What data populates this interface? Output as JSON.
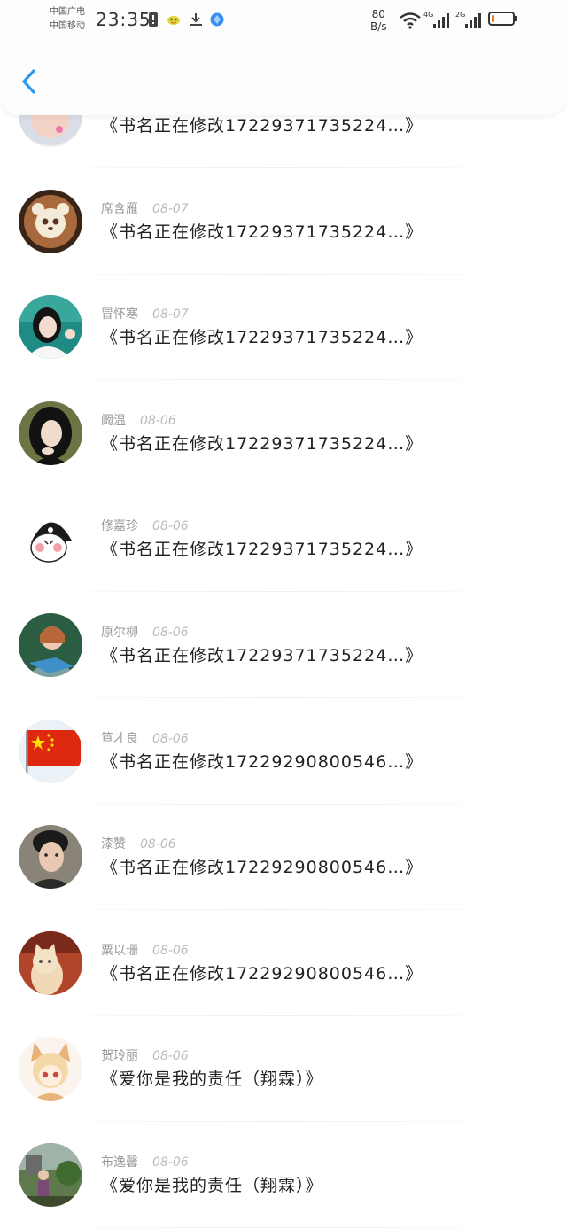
{
  "status_bar": {
    "carrier_1": "中国广电",
    "carrier_2": "中国移动",
    "time": "23:35",
    "net_speed_value": "80",
    "net_speed_unit": "B/s",
    "signal_1_label": "4G",
    "signal_2_label": "2G",
    "battery_level": 0.15,
    "battery_color": "#f07a1a"
  },
  "header": {
    "back_icon": "chevron-left-icon",
    "accent": "#2b9af3"
  },
  "items": [
    {
      "user": "",
      "date": "",
      "book": "《书名正在修改17229371735224…》",
      "avatar": "girl-partial"
    },
    {
      "user": "席含雁",
      "date": "08-07",
      "book": "《书名正在修改17229371735224…》",
      "avatar": "panda-latte"
    },
    {
      "user": "冒怀寒",
      "date": "08-07",
      "book": "《书名正在修改17229371735224…》",
      "avatar": "girl-portrait"
    },
    {
      "user": "阚温",
      "date": "08-06",
      "book": "《书名正在修改17229371735224…》",
      "avatar": "girl-dark-hair"
    },
    {
      "user": "修嘉珍",
      "date": "08-06",
      "book": "《书名正在修改17229371735224…》",
      "avatar": "cartoon-character"
    },
    {
      "user": "原尔柳",
      "date": "08-06",
      "book": "《书名正在修改17229371735224…》",
      "avatar": "girl-reading"
    },
    {
      "user": "笪才良",
      "date": "08-06",
      "book": "《书名正在修改17229290800546…》",
      "avatar": "china-flag"
    },
    {
      "user": "漆赞",
      "date": "08-06",
      "book": "《书名正在修改17229290800546…》",
      "avatar": "boy-portrait"
    },
    {
      "user": "粟以珊",
      "date": "08-06",
      "book": "《书名正在修改17229290800546…》",
      "avatar": "kitten"
    },
    {
      "user": "贺玲丽",
      "date": "08-06",
      "book": "《爱你是我的责任（翔霖）》",
      "avatar": "anime-fox-girl"
    },
    {
      "user": "布逸馨",
      "date": "08-06",
      "book": "《爱你是我的责任（翔霖）》",
      "avatar": "girl-garden"
    }
  ]
}
